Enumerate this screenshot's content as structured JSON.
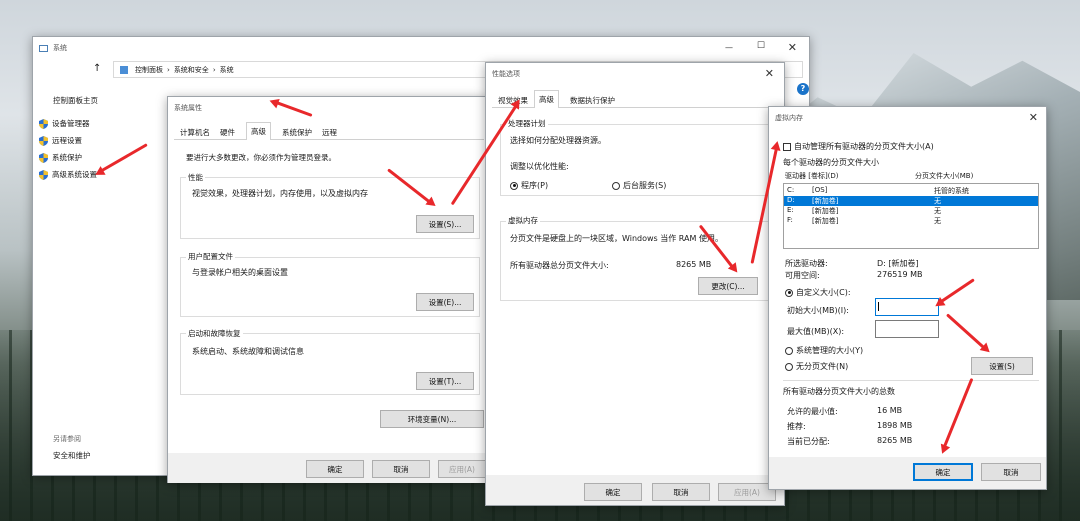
{
  "colors": {
    "accent": "#0078d7",
    "annotation_arrow": "#e8282b",
    "selected_row": "#0078d7"
  },
  "system_window": {
    "title": "系统",
    "breadcrumb": [
      "控制面板",
      "系统和安全",
      "系统"
    ],
    "sidebar": {
      "home": "控制面板主页",
      "items": [
        "设备管理器",
        "远程设置",
        "系统保护",
        "高级系统设置"
      ],
      "see_also_label": "另请参阅",
      "see_also_items": [
        "安全和维护"
      ]
    }
  },
  "system_properties": {
    "title": "系统属性",
    "tabs": [
      "计算机名",
      "硬件",
      "高级",
      "系统保护",
      "远程"
    ],
    "active_tab": "高级",
    "admin_note": "要进行大多数更改，你必须作为管理员登录。",
    "performance": {
      "title": "性能",
      "desc": "视觉效果，处理器计划，内存使用，以及虚拟内存",
      "button": "设置(S)..."
    },
    "user_profiles": {
      "title": "用户配置文件",
      "desc": "与登录帐户相关的桌面设置",
      "button": "设置(E)..."
    },
    "startup_recovery": {
      "title": "启动和故障恢复",
      "desc": "系统启动、系统故障和调试信息",
      "button": "设置(T)..."
    },
    "env_button": "环境变量(N)...",
    "ok": "确定",
    "cancel": "取消",
    "apply": "应用(A)"
  },
  "performance_options": {
    "title": "性能选项",
    "tabs": [
      "视觉效果",
      "高级",
      "数据执行保护"
    ],
    "active_tab": "高级",
    "scheduling": {
      "title": "处理器计划",
      "desc": "选择如何分配处理器资源。",
      "adjust_label": "调整以优化性能:",
      "option_programs": "程序(P)",
      "option_background": "后台服务(S)"
    },
    "virtual_memory": {
      "title": "虚拟内存",
      "desc": "分页文件是硬盘上的一块区域，Windows 当作 RAM 使用。",
      "total_label": "所有驱动器总分页文件大小:",
      "total_value": "8265 MB",
      "change_button": "更改(C)..."
    },
    "ok": "确定",
    "cancel": "取消",
    "apply": "应用(A)"
  },
  "virtual_memory": {
    "title": "虚拟内存",
    "auto_manage": "自动管理所有驱动器的分页文件大小(A)",
    "per_drive_label": "每个驱动器的分页文件大小",
    "col_drive": "驱动器 [卷标](D)",
    "col_size": "分页文件大小(MB)",
    "drives": [
      {
        "drive": "C:",
        "label": "[OS]",
        "size": "托管的系统"
      },
      {
        "drive": "D:",
        "label": "[新加卷]",
        "size": "无"
      },
      {
        "drive": "E:",
        "label": "[新加卷]",
        "size": "无"
      },
      {
        "drive": "F:",
        "label": "[新加卷]",
        "size": "无"
      }
    ],
    "selected_drive_label": "所选驱动器:",
    "selected_drive_value": "D:  [新加卷]",
    "free_space_label": "可用空间:",
    "free_space_value": "276519 MB",
    "custom_size": "自定义大小(C):",
    "initial_size_label": "初始大小(MB)(I):",
    "initial_size_value": "",
    "max_size_label": "最大值(MB)(X):",
    "max_size_value": "",
    "system_managed": "系统管理的大小(Y)",
    "no_paging": "无分页文件(N)",
    "set_button": "设置(S)",
    "total_title": "所有驱动器分页文件大小的总数",
    "min_allowed_label": "允许的最小值:",
    "min_allowed_value": "16 MB",
    "recommended_label": "推荐:",
    "recommended_value": "1898 MB",
    "allocated_label": "当前已分配:",
    "allocated_value": "8265 MB",
    "ok": "确定",
    "cancel": "取消"
  },
  "icons": {
    "help": "?",
    "up": "↑",
    "close": "✕",
    "minimize": "—",
    "maximize": "☐"
  }
}
